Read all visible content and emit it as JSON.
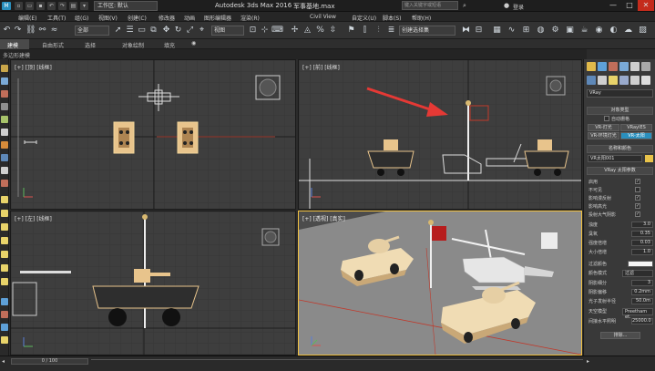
{
  "titlebar": {
    "app_icon_label": "M",
    "workspace": "工作区: 默认",
    "app_title": "Autodesk 3ds Max 2016",
    "file_title": "军事基地.max",
    "search_placeholder": "键入关键字或短语",
    "login": "登录",
    "minimize": "—",
    "maximize": "□",
    "close": "✕"
  },
  "menu": [
    "编辑(E)",
    "工具(T)",
    "组(G)",
    "视图(V)",
    "创建(C)",
    "修改器",
    "动画",
    "图形编辑器",
    "渲染(R)",
    "Civil View",
    "自定义(U)",
    "脚本(S)",
    "帮助(H)"
  ],
  "toolbar": {
    "filter": "全部",
    "view": "视图",
    "selection_set": "创建选择集"
  },
  "ribbon": {
    "tabs": [
      "建模",
      "自由形式",
      "选择",
      "对象绘制",
      "填充"
    ],
    "sub": "多边形建模"
  },
  "viewports": {
    "top": "[+] [顶] [线框]",
    "front": "[+] [前] [线框]",
    "left": "[+] [左] [线框]",
    "perspective": "[+] [透视] [真实]"
  },
  "cmdpanel": {
    "dropdown": "VRay",
    "object_type_title": "对象类型",
    "auto_grid": "自动栅格",
    "buttons": [
      "VR-灯光",
      "VRayIES",
      "VR-环境灯光",
      "VR-太阳"
    ],
    "name_color_title": "名称和颜色",
    "name_value": "VR太阳001",
    "params_title": "VRay 太阳参数",
    "params": [
      {
        "label": "启用",
        "value": ""
      },
      {
        "label": "不可见",
        "value": ""
      },
      {
        "label": "影响漫反射",
        "value": ""
      },
      {
        "label": "影响高光",
        "value": ""
      },
      {
        "label": "投射大气阴影",
        "value": ""
      },
      {
        "label": "浊度",
        "value": "3.0"
      },
      {
        "label": "臭氧",
        "value": "0.35"
      },
      {
        "label": "强度倍增",
        "value": "0.03"
      },
      {
        "label": "大小倍增",
        "value": "1.0"
      },
      {
        "label": "过滤颜色",
        "value": ""
      },
      {
        "label": "颜色模式",
        "value": "过滤"
      },
      {
        "label": "阴影细分",
        "value": "3"
      },
      {
        "label": "阴影偏移",
        "value": "0.2mm"
      },
      {
        "label": "光子发射半径",
        "value": "50.0m"
      },
      {
        "label": "天空模型",
        "value": "Preetham et."
      },
      {
        "label": "间接水平照明",
        "value": "25000.0"
      }
    ],
    "exclude": "排除..."
  },
  "timeline": {
    "slider": "0 / 100"
  },
  "colors": {
    "accent_blue": "#2a8fbd",
    "arrow_red": "#e53935",
    "vehicle_tan": "#e8c48c",
    "grid_dark": "#3c3c3c",
    "highlight_yellow": "#f0c040"
  }
}
